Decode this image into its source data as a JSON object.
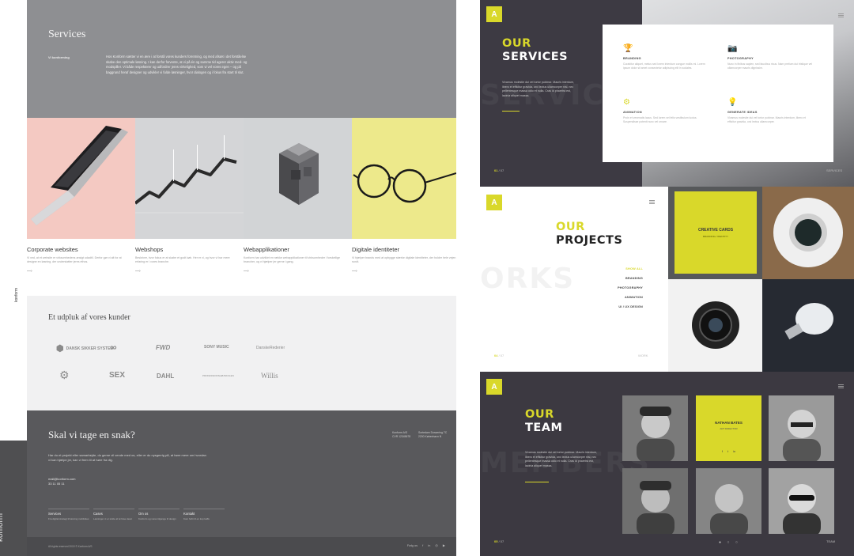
{
  "left": {
    "brand": "konform",
    "side_mark": "konform",
    "services": {
      "title": "Services",
      "sub": "Vi konforming",
      "text": "Hos Konform sætter vi en ære i at forstå vores kunders forretning, og med afsæt i det forståelse skabe den optimale løsning. I kan derfor forvente, at vi på én og samme tid agerer aktiv med- og modspiller. Vi både respekterer og udfordrer jeres virkelighed, som vi vel vores egen – og på baggrund heraf designer og udvikler vi fulde løsninger, hvor dialogen og i fokus fra start til slut."
    },
    "tiles": [
      {
        "title": "Corporate websites",
        "desc": "Vi ved, at et website er virksomhedens ansigt udadtil. Derfor gør vi alt for at designe en løsning, der understøtter jeres ethos.",
        "arrow": "—›"
      },
      {
        "title": "Webshops",
        "desc": "Beskriver, hvor fokus er at skabe et godt køb. Her er vi, og hvor vi har mere erfaring er i vores branche.",
        "arrow": "—›"
      },
      {
        "title": "Webapplikationer",
        "desc": "Konform har udviklet en række webapplikationer til virksomheder i forskellige brancher, og vi hjælper jer gerne i gang.",
        "arrow": "—›"
      },
      {
        "title": "Digitale identiteter",
        "desc": "Vi hjælper brands med at opbygge stærke digitale identiteter, der holder hele vejen rundt.",
        "arrow": "—›"
      }
    ],
    "chart_labels": [
      "",
      "",
      "",
      ""
    ],
    "clients": {
      "title": "Et udpluk af vores kunder",
      "logos": [
        "DANSK SIKKER SYSTEM",
        "∞",
        "FWD",
        "SONY MUSIC",
        "DanskeRederier",
        "⚙",
        "SEX",
        "DAHL",
        "PROFESSIONSHØJSKOLEN",
        "Willis"
      ]
    },
    "contact": {
      "title": "Skal vi tage en snak?",
      "text": "Har du et projekt eller samarbejde, du gerne vil vende med os, eller er du nysgerrig på, at høre mere om hvordan vi kan hjælpe jer, kan vi frem til at høre fra dig.",
      "mail": "mail@konform.com",
      "phone": "33 11 05 11",
      "addr1": "Konform A/S\nCVR 12345678",
      "addr2": "Sortedam Dossering 7C\n2200 København N",
      "cols": [
        {
          "h": "Services",
          "s": "Fra digital strategi til løsning mobilsites"
        },
        {
          "h": "Cases",
          "s": "Løsninger vi er stolte af at have lavet"
        },
        {
          "h": "Om os",
          "s": "Konform og vores tilgange til design"
        },
        {
          "h": "Kontakt",
          "s": "Kom forbi til en kop kaffe"
        }
      ],
      "copyright": "All rights reserved 2015 © Konform A/S",
      "follow": "Følg os",
      "social": [
        "f",
        "in",
        "◎",
        "▶"
      ]
    }
  },
  "slides": {
    "services": {
      "logo": "A",
      "title_line1": "OUR",
      "title_line2": "SERVICES",
      "ghost": "SERVICE",
      "copy": "Vivamus molestie dui vel tortor pulvinar. Mauris interdum, libero et efficitur gravida, orci lectus ullamcorper nisi, nec pellentesque massa odio et nulla. Cras id pharetra est, lacinia aliquet massa.",
      "pager_cur": "01",
      "pager_total": "07",
      "right_tag": "SERVICES",
      "items": [
        {
          "icon": "trophy-icon",
          "glyph": "🏆",
          "h": "BRANDING",
          "p": "Curabitur aliquet, metus sed lorem interdum congue mollis mi. Lorem ipsum dolor sit amet consectetur adipiscing elit in sodales."
        },
        {
          "icon": "camera-icon",
          "glyph": "📷",
          "h": "PHOTOGRAPHY",
          "p": "Nunc in finibus sapien, sed faucibus risus. Nam pretium dui tristique vel ullamcorper mauris dignissim."
        },
        {
          "icon": "gear-icon",
          "glyph": "⚙",
          "h": "ANIMATION",
          "p": "Proin et venenatis lacus. Sed lorem vel felis vestibulum luctus. Suspendisse potenti nunc vel ornare."
        },
        {
          "icon": "bulb-icon",
          "glyph": "💡",
          "h": "GENERATE IDEAS",
          "p": "Vivamus molestie dui vel tortor pulvinar. Mauris interdum, libero et efficitur gravida, orci lectus ullamcorper."
        }
      ]
    },
    "projects": {
      "logo": "A",
      "title_line1": "OUR",
      "title_line2": "PROJECTS",
      "ghost": "ORKS",
      "menu": [
        "SHOW ALL",
        "BRANDING",
        "PHOTOGRAPHY",
        "ANIMATION",
        "UI / UX DESIGN"
      ],
      "pager_cur": "04",
      "pager_total": "07",
      "right_tag": "WORK",
      "card_title": "CREATIVE CARDS",
      "card_sub": "BRANDING / IDENTITY"
    },
    "team": {
      "logo": "A",
      "title_line1": "OUR",
      "title_line2": "TEAM",
      "ghost": "MEMBERS",
      "copy": "Vivamus molestie dui vel tortor pulvinar. Mauris interdum, libero et efficitur gravida, orci lectus ullamcorper nisi, nec pellentesque massa odio et nulla. Cras id pharetra est, lacinia aliquet massa.",
      "pager_cur": "05",
      "pager_total": "07",
      "right_tag": "TEAM",
      "highlight_name": "NATHAN BATES",
      "highlight_role": "ART DIRECTOR",
      "social": [
        "f",
        "t",
        "in"
      ]
    }
  },
  "colors": {
    "accent": "#d9d82a",
    "left_band": "#8e8f92",
    "contact_bg": "#59595c",
    "slide_dark": "#3c3941"
  }
}
